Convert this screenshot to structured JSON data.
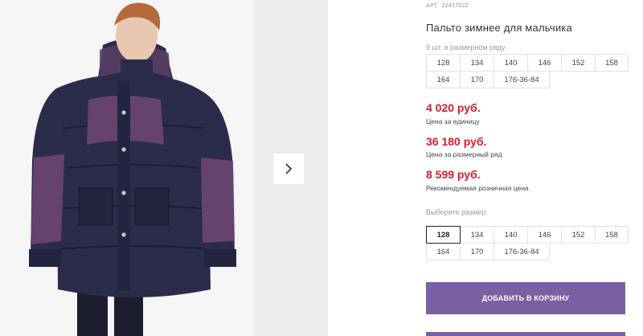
{
  "product": {
    "sku_label": "АРТ",
    "sku_value": "22417022",
    "title": "Пальто зимнее для мальчика"
  },
  "size_row": {
    "hint": "9 шт. в размерном ряду",
    "sizes": [
      "128",
      "134",
      "140",
      "146",
      "152",
      "158",
      "164",
      "170",
      "176-36-84"
    ]
  },
  "prices": {
    "unit_price": "4 020 руб.",
    "unit_caption": "Цена за единицу",
    "row_price": "36 180 руб.",
    "row_caption": "Цена за размерный ряд",
    "retail_price": "8 599 руб.",
    "retail_caption": "Рекомендуемая розничная цена"
  },
  "size_picker": {
    "label": "Выберите размер:",
    "sizes": [
      "128",
      "134",
      "140",
      "146",
      "152",
      "158",
      "164",
      "170",
      "176-36-84"
    ],
    "selected": "128"
  },
  "actions": {
    "add_to_cart": "ДОБАВИТЬ В КОРЗИНУ"
  },
  "icons": {
    "next": "chevron-right-icon"
  },
  "colors": {
    "price": "#d21e2b",
    "button": "#7a5fa3",
    "coat": "#2a2c4a",
    "coat_accent": "#6b4670"
  }
}
